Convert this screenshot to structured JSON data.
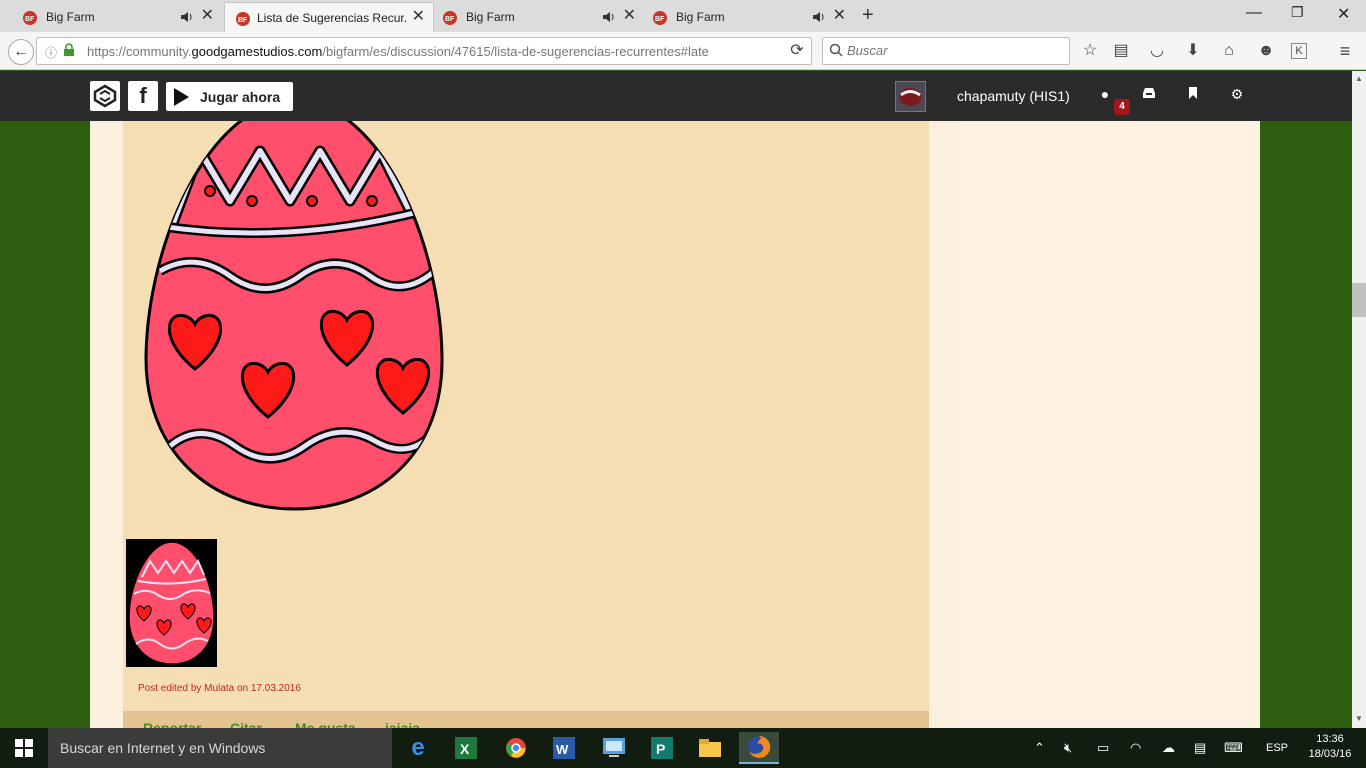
{
  "browser": {
    "tabs": [
      {
        "label": "Big Farm",
        "active": false,
        "audio": true
      },
      {
        "label": "Lista de Sugerencias Recur...",
        "active": true,
        "audio": false
      },
      {
        "label": "Big Farm",
        "active": false,
        "audio": true
      },
      {
        "label": "Big Farm",
        "active": false,
        "audio": true
      }
    ],
    "new_tab_label": "+",
    "url_prefix": "https://community.",
    "url_domain": "goodgamestudios.com",
    "url_path": "/bigfarm/es/discussion/47615/lista-de-sugerencias-recurrentes#late",
    "search_placeholder": "Buscar"
  },
  "site": {
    "play_button": "Jugar ahora",
    "username": "chapamuty (HIS1)",
    "notification_count": "4"
  },
  "post": {
    "edited_prefix": "Post edited by ",
    "edited_author": "Mulata",
    "edited_on": " on ",
    "edited_date": "17.03.2016",
    "actions": [
      "Reportar",
      "Citar",
      "Me gusta",
      "jajaja"
    ]
  },
  "taskbar": {
    "search_placeholder": "Buscar en Internet y en Windows",
    "language": "ESP",
    "time": "13:36",
    "date": "18/03/16"
  },
  "colors": {
    "post_bg": "#f5deb3",
    "page_green": "#2e5f10",
    "egg_pink": "#ff4f6d",
    "heart_red": "#ff1a1a",
    "accent_green": "#4e8a1d",
    "edited_red": "#c0262b"
  }
}
